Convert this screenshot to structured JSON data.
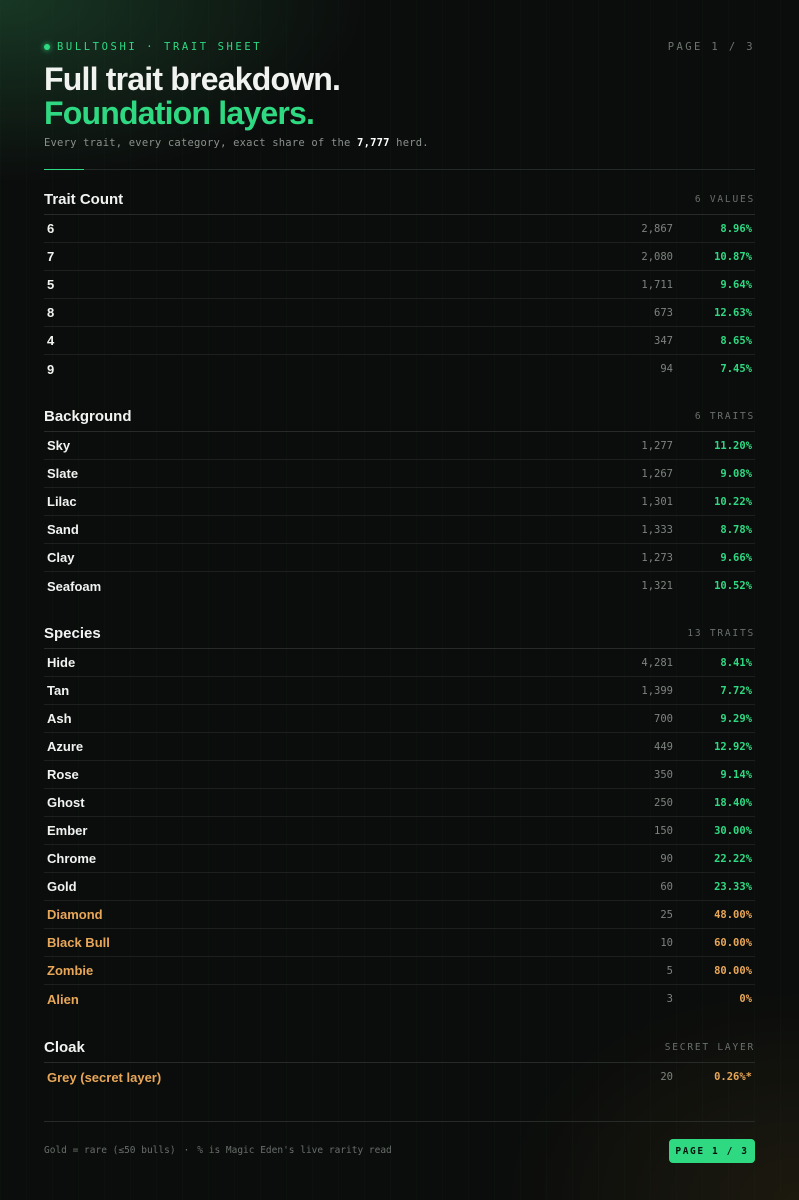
{
  "header": {
    "brand": "BULLTOSHI · TRAIT SHEET",
    "page_label": "PAGE 1 / 3",
    "title_line1": "Full trait breakdown.",
    "title_line2": "Foundation layers.",
    "subtitle_prefix": "Every trait, every category, exact share of the ",
    "subtitle_count": "7,777",
    "subtitle_suffix": " herd."
  },
  "colors": {
    "accent": "#2fd982",
    "rare": "#e8a758",
    "background": "#0b0d0c"
  },
  "sections": [
    {
      "title": "Trait Count",
      "meta": "6 VALUES",
      "rows": [
        {
          "name": "6",
          "count": "2,867",
          "pct": "8.96%",
          "rare": false
        },
        {
          "name": "7",
          "count": "2,080",
          "pct": "10.87%",
          "rare": false
        },
        {
          "name": "5",
          "count": "1,711",
          "pct": "9.64%",
          "rare": false
        },
        {
          "name": "8",
          "count": "673",
          "pct": "12.63%",
          "rare": false
        },
        {
          "name": "4",
          "count": "347",
          "pct": "8.65%",
          "rare": false
        },
        {
          "name": "9",
          "count": "94",
          "pct": "7.45%",
          "rare": false
        }
      ]
    },
    {
      "title": "Background",
      "meta": "6 TRAITS",
      "rows": [
        {
          "name": "Sky",
          "count": "1,277",
          "pct": "11.20%",
          "rare": false
        },
        {
          "name": "Slate",
          "count": "1,267",
          "pct": "9.08%",
          "rare": false
        },
        {
          "name": "Lilac",
          "count": "1,301",
          "pct": "10.22%",
          "rare": false
        },
        {
          "name": "Sand",
          "count": "1,333",
          "pct": "8.78%",
          "rare": false
        },
        {
          "name": "Clay",
          "count": "1,273",
          "pct": "9.66%",
          "rare": false
        },
        {
          "name": "Seafoam",
          "count": "1,321",
          "pct": "10.52%",
          "rare": false
        }
      ]
    },
    {
      "title": "Species",
      "meta": "13 TRAITS",
      "rows": [
        {
          "name": "Hide",
          "count": "4,281",
          "pct": "8.41%",
          "rare": false
        },
        {
          "name": "Tan",
          "count": "1,399",
          "pct": "7.72%",
          "rare": false
        },
        {
          "name": "Ash",
          "count": "700",
          "pct": "9.29%",
          "rare": false
        },
        {
          "name": "Azure",
          "count": "449",
          "pct": "12.92%",
          "rare": false
        },
        {
          "name": "Rose",
          "count": "350",
          "pct": "9.14%",
          "rare": false
        },
        {
          "name": "Ghost",
          "count": "250",
          "pct": "18.40%",
          "rare": false
        },
        {
          "name": "Ember",
          "count": "150",
          "pct": "30.00%",
          "rare": false
        },
        {
          "name": "Chrome",
          "count": "90",
          "pct": "22.22%",
          "rare": false
        },
        {
          "name": "Gold",
          "count": "60",
          "pct": "23.33%",
          "rare": false
        },
        {
          "name": "Diamond",
          "count": "25",
          "pct": "48.00%",
          "rare": true
        },
        {
          "name": "Black Bull",
          "count": "10",
          "pct": "60.00%",
          "rare": true
        },
        {
          "name": "Zombie",
          "count": "5",
          "pct": "80.00%",
          "rare": true
        },
        {
          "name": "Alien",
          "count": "3",
          "pct": "0%",
          "rare": true
        }
      ]
    },
    {
      "title": "Cloak",
      "meta": "SECRET LAYER",
      "rows": [
        {
          "name": "Grey (secret layer)",
          "count": "20",
          "pct": "0.26%*",
          "rare": true
        }
      ]
    }
  ],
  "footer": {
    "note_left": "Gold = rare (≤50 bulls)",
    "note_sep": "·",
    "note_right": "% is Magic Eden's live rarity read",
    "page_label": "PAGE 1 / 3"
  }
}
